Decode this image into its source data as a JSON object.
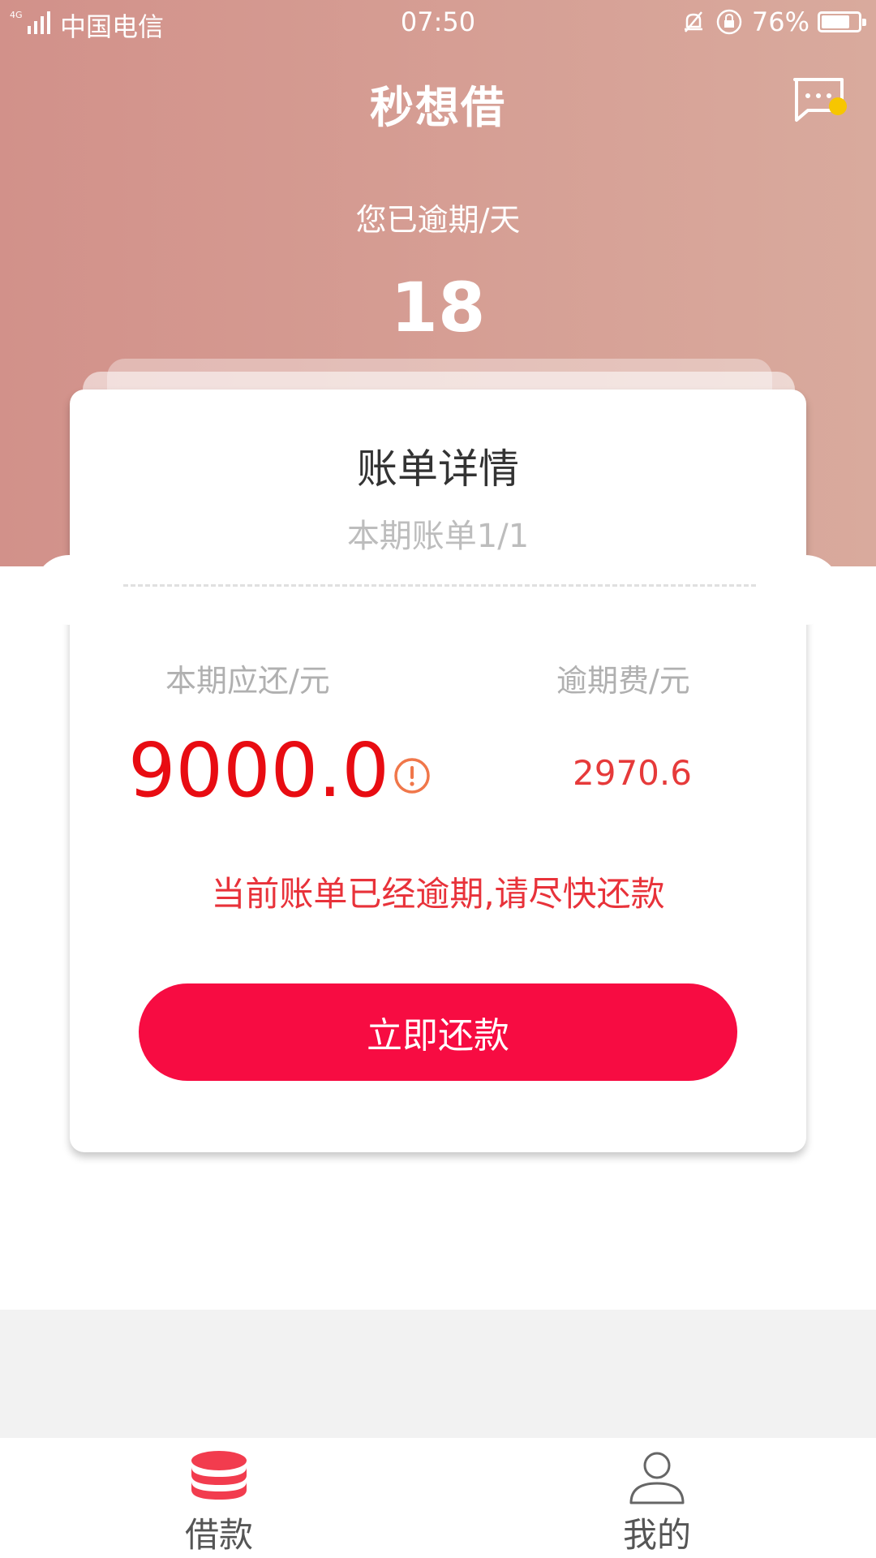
{
  "status_bar": {
    "carrier": "中国电信",
    "network": "4G",
    "time": "07:50",
    "battery": "76%"
  },
  "header": {
    "title": "秒想借",
    "overdue_label": "您已逾期/天",
    "overdue_days": "18",
    "message_icon": "message-icon"
  },
  "card": {
    "title": "账单详情",
    "subtitle": "本期账单1/1",
    "due_label": "本期应还/元",
    "fee_label": "逾期费/元",
    "due_amount": "9000.0",
    "fee_amount": "2970.6",
    "notice": "当前账单已经逾期,请尽快还款",
    "pay_button": "立即还款"
  },
  "tabbar": {
    "items": [
      {
        "label": "借款",
        "icon": "coins-stack-icon",
        "active": true
      },
      {
        "label": "我的",
        "icon": "person-icon",
        "active": false
      }
    ]
  },
  "colors": {
    "header_start": "#d2918a",
    "header_end": "#d9aa9d",
    "accent_red": "#f70c42",
    "amount_red": "#e80c12",
    "notify_dot": "#f7c600"
  }
}
